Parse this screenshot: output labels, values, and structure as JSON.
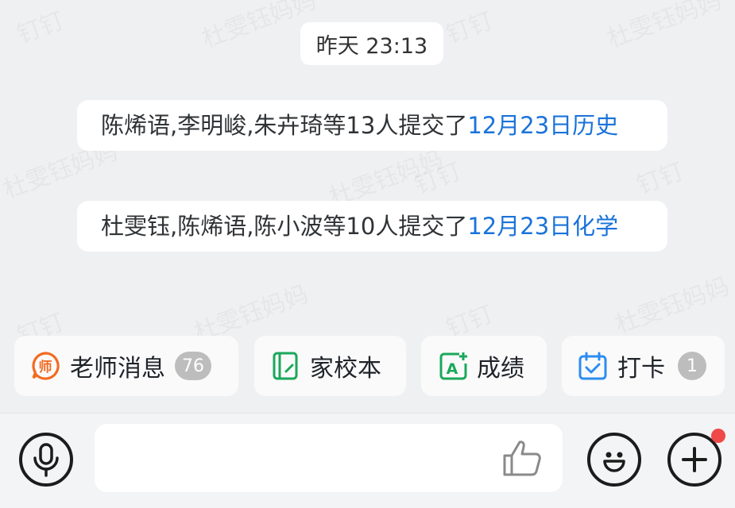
{
  "watermark": {
    "texts": [
      "钉钉",
      "杜雯钰妈妈",
      "杜雯钰妈妈",
      "钉钉",
      "杜雯钰妈妈",
      "钉钉",
      "杜雯钰妈妈",
      "钉钉",
      "杜雯钰妈妈",
      "钉钉",
      "杜雯钰妈妈",
      "钉钉"
    ]
  },
  "timestamp": "昨天 23:13",
  "messages": [
    {
      "prefix": "陈烯语,李明峻,朱卉琦等13人提交了",
      "link": "12月23日历史"
    },
    {
      "prefix": "杜雯钰,陈烯语,陈小波等10人提交了",
      "link": "12月23日化学"
    }
  ],
  "quick_actions": [
    {
      "label": "老师消息",
      "icon": "teacher-icon",
      "badge": "76",
      "color": "#f26b21"
    },
    {
      "label": "家校本",
      "icon": "notebook-icon",
      "color": "#1aa85a"
    },
    {
      "label": "成绩",
      "icon": "grade-icon",
      "color": "#1aa85a"
    },
    {
      "label": "打卡",
      "icon": "calendar-check-icon",
      "badge": "1",
      "color": "#2d8cf0"
    }
  ],
  "input": {
    "placeholder": ""
  },
  "icons": {
    "voice": "microphone-icon",
    "like": "thumbs-up-icon",
    "emoji": "smiley-icon",
    "more": "plus-icon"
  },
  "colors": {
    "link": "#1a73d9",
    "background": "#eff0f2",
    "notification_dot": "#f04848"
  }
}
